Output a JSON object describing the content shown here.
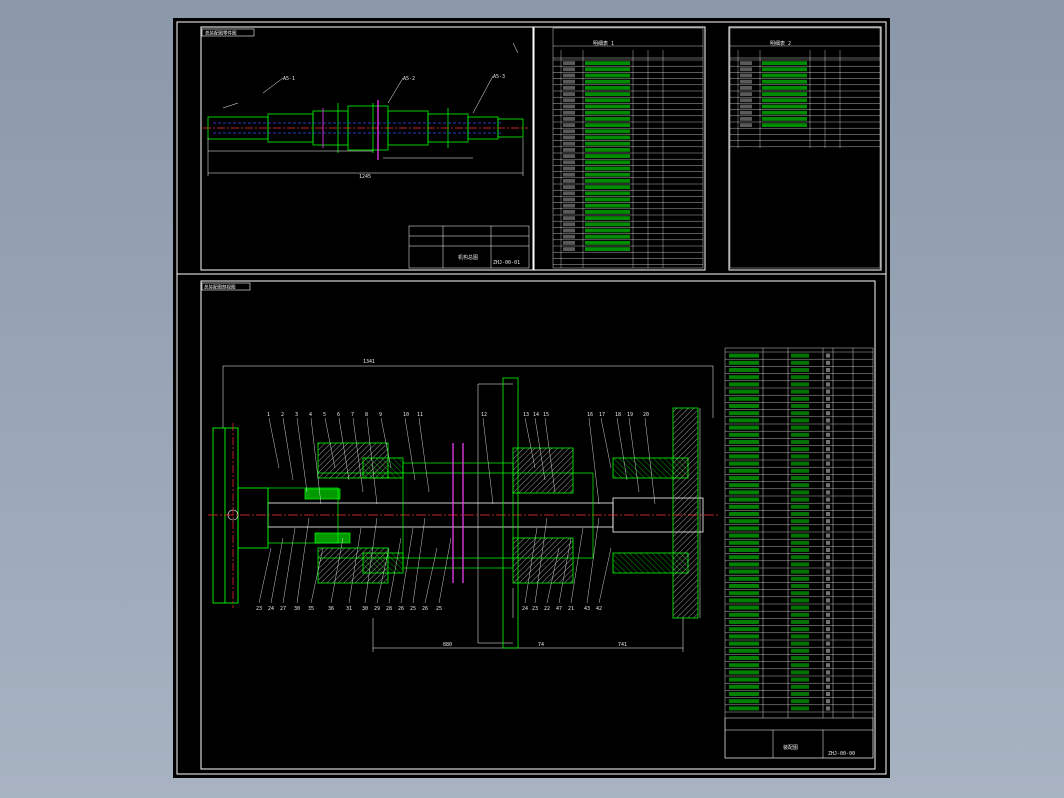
{
  "colors": {
    "background": "#8c99aa",
    "sheet": "#000000",
    "frame": "#ffffff",
    "outline": "#00ff00",
    "centerline": "#ff3030",
    "hidden": "#3050ff",
    "section": "#ff40ff",
    "dimension": "#ffffff"
  },
  "top_drawing": {
    "tag": "总装配图零件图",
    "title_block": {
      "name": "机构总图",
      "drawing_no": "ZHJ-00-01"
    }
  },
  "bom_tables": {
    "header_col_labels": [
      "序号",
      "代号",
      "名称",
      "数量",
      "备注"
    ],
    "table1_title": "明细表 1",
    "table2_title": "明细表 2"
  },
  "bottom_drawing": {
    "tag": "总装配图剖视图",
    "overall_dim": "1341",
    "dim_bottom_left": "880",
    "dim_bottom_mid": "74",
    "dim_bottom_right": "741",
    "title_block": {
      "name": "装配图",
      "drawing_no": "ZHJ-00-00"
    },
    "callouts_top": [
      "1",
      "2",
      "3",
      "4",
      "5",
      "6",
      "7",
      "8",
      "9",
      "10",
      "11",
      "12",
      "13",
      "14",
      "15",
      "16",
      "17",
      "18",
      "19",
      "20"
    ],
    "callouts_bottom": [
      "23",
      "24",
      "27",
      "30",
      "35",
      "36",
      "31",
      "30",
      "29",
      "28",
      "26",
      "25",
      "26",
      "25",
      "24",
      "23",
      "22",
      "47",
      "21",
      "43",
      "42"
    ]
  }
}
